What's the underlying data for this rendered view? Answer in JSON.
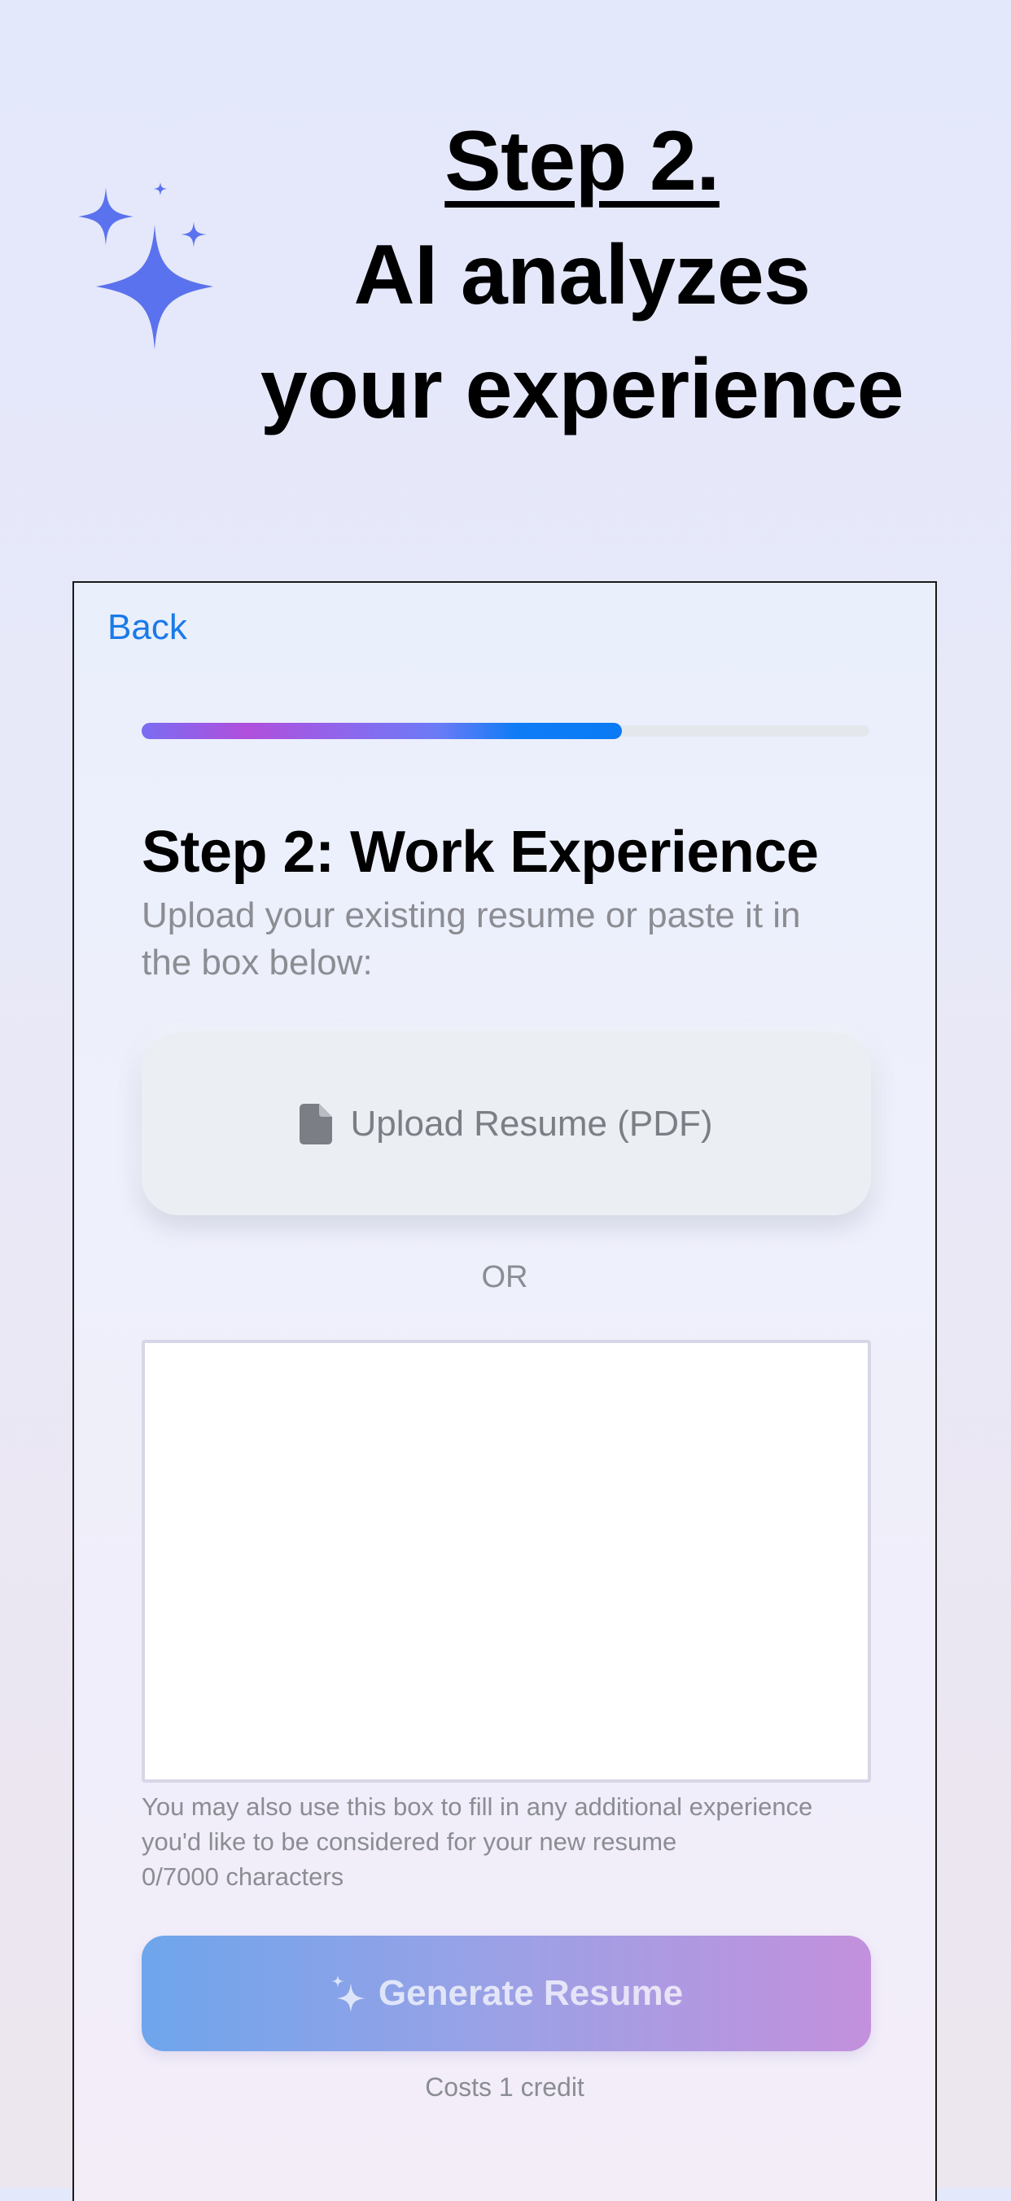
{
  "marketing": {
    "step_label": "Step 2.",
    "headline_line1": "AI analyzes",
    "headline_line2": "your experience"
  },
  "app": {
    "back_label": "Back",
    "progress_fraction": 0.66,
    "section_title": "Step 2: Work Experience",
    "section_subtitle": "Upload your existing resume or paste it in the box below:",
    "upload_button_label": "Upload Resume (PDF)",
    "or_label": "OR",
    "textarea_value": "",
    "helper_line1": "You may also use this box to fill in any additional experience",
    "helper_line2": "you'd like to be considered for your new resume",
    "char_count": "0/7000 characters",
    "generate_button_label": "Generate Resume",
    "cost_label": "Costs 1 credit"
  },
  "colors": {
    "accent_blue": "#1a7ae8",
    "sparkle_blue": "#5b72ee",
    "progress_start": "#7a6df2",
    "progress_mid": "#b04fdc",
    "progress_end": "#0a7af5",
    "generate_start": "#6ea5ec",
    "generate_end": "#c390dc"
  },
  "icons": {
    "decoration": "sparkles-icon",
    "upload": "document-icon",
    "generate": "sparkle-icon"
  }
}
